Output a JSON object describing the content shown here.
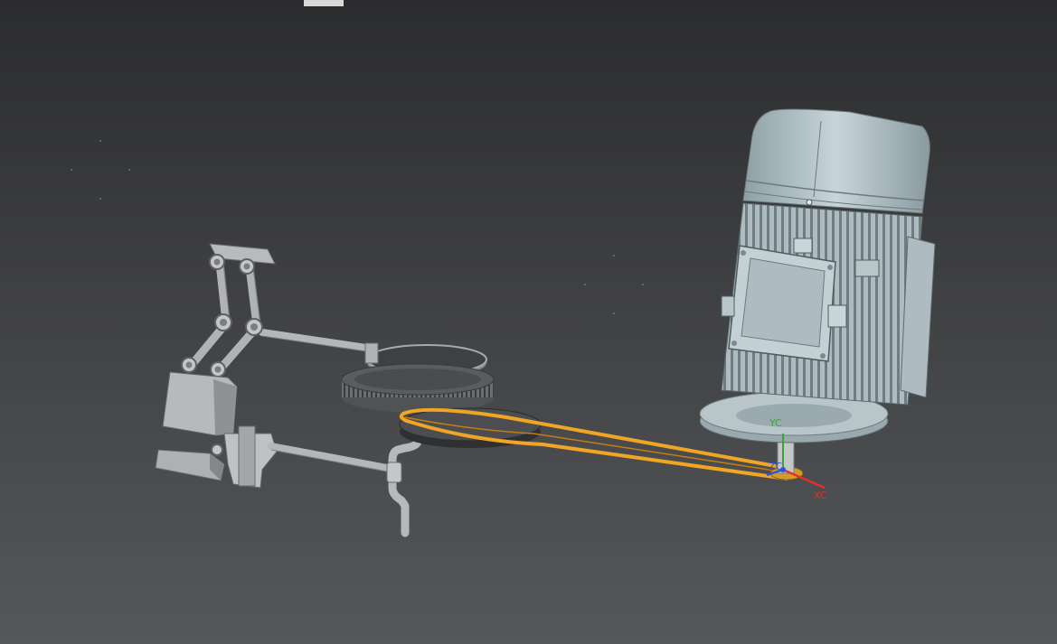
{
  "viewport": {
    "background_top": "#2b2c2e",
    "background_bottom": "#55575a"
  },
  "model": {
    "components": [
      "electric-motor",
      "motor-flange",
      "motor-shaft",
      "belt-drive",
      "drive-pulley",
      "spur-gear",
      "disc-plate",
      "crank-shaft",
      "linkage-arm",
      "bracket-block",
      "slider-block",
      "base-block"
    ],
    "belt_color": "#f0a624",
    "part_color": "#c9cbcd",
    "motor_color": "#b9c8cc"
  },
  "triad": {
    "x_label": "XC",
    "y_label": "YC",
    "z_label": "ZC",
    "x_color": "#e0312a",
    "y_color": "#3fa33a",
    "z_color": "#2c55d6"
  }
}
